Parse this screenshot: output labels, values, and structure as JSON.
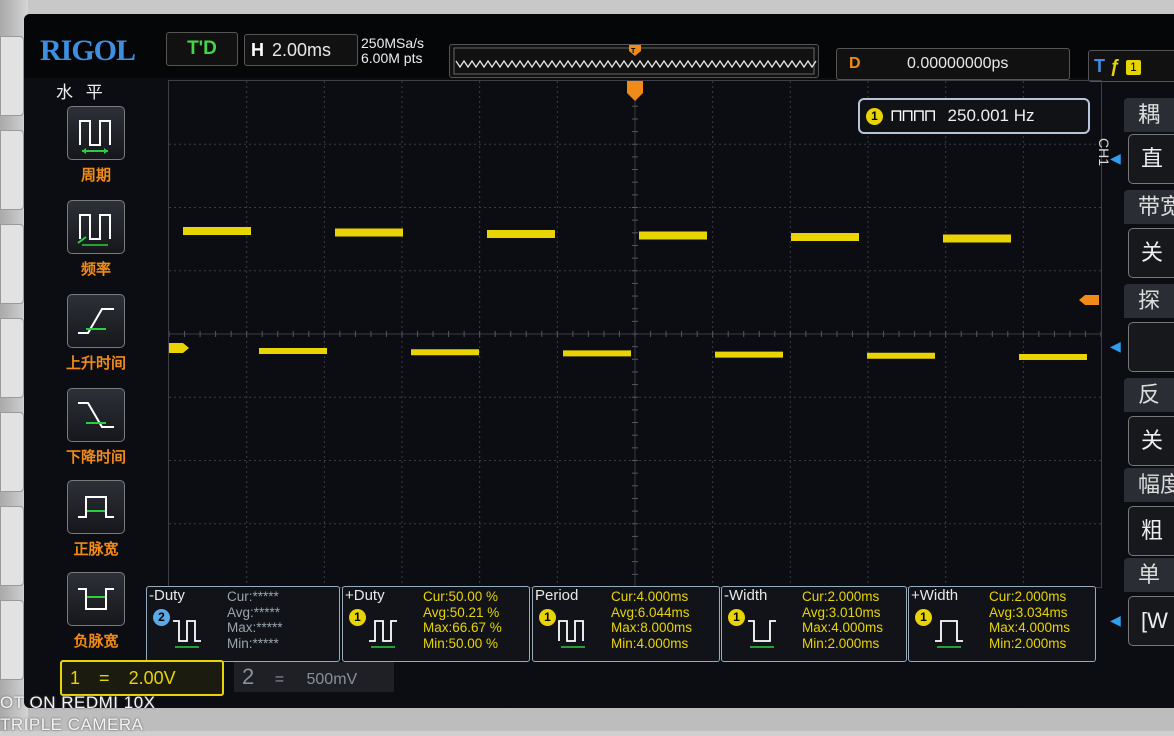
{
  "brand": "RIGOL",
  "status": "T'D",
  "timebase": {
    "label": "H",
    "value": "2.00ms"
  },
  "acquisition": {
    "sample_rate": "250MSa/s",
    "points": "6.00M pts"
  },
  "delay": {
    "label": "D",
    "value": "0.00000000ps"
  },
  "trigger": {
    "label": "T",
    "channel": "1"
  },
  "left_menu": {
    "title": "水 平",
    "items": [
      {
        "label": "周期",
        "icon": "period-icon"
      },
      {
        "label": "频率",
        "icon": "frequency-icon"
      },
      {
        "label": "上升时间",
        "icon": "rise-time-icon"
      },
      {
        "label": "下降时间",
        "icon": "fall-time-icon"
      },
      {
        "label": "正脉宽",
        "icon": "positive-width-icon"
      },
      {
        "label": "负脉宽",
        "icon": "negative-width-icon"
      }
    ]
  },
  "right_menu": [
    {
      "head": "耦",
      "value": "直"
    },
    {
      "head": "带宽",
      "value": "关"
    },
    {
      "head": "探",
      "value": ""
    },
    {
      "head": "反",
      "value": "关"
    },
    {
      "head": "幅度",
      "value": "粗"
    },
    {
      "head": "单",
      "value": "[W"
    }
  ],
  "right_menu_side_label": "CH1",
  "frequency_counter": {
    "channel": "1",
    "value": "250.001 Hz"
  },
  "measurements": [
    {
      "title": "-Duty",
      "channel": "2",
      "cur": "Cur:*****",
      "avg": "Avg:*****",
      "max": "Max:*****",
      "min": "Min:*****"
    },
    {
      "title": "+Duty",
      "channel": "1",
      "cur": "Cur:50.00 %",
      "avg": "Avg:50.21 %",
      "max": "Max:66.67 %",
      "min": "Min:50.00 %"
    },
    {
      "title": "Period",
      "channel": "1",
      "cur": "Cur:4.000ms",
      "avg": "Avg:6.044ms",
      "max": "Max:8.000ms",
      "min": "Min:4.000ms"
    },
    {
      "title": "-Width",
      "channel": "1",
      "cur": "Cur:2.000ms",
      "avg": "Avg:3.010ms",
      "max": "Max:4.000ms",
      "min": "Min:2.000ms"
    },
    {
      "title": "+Width",
      "channel": "1",
      "cur": "Cur:2.000ms",
      "avg": "Avg:3.034ms",
      "max": "Max:4.000ms",
      "min": "Min:2.000ms"
    }
  ],
  "channels": [
    {
      "num": "1",
      "sep": "=",
      "scale": "2.00V"
    },
    {
      "num": "2",
      "sep": "=",
      "scale": "500mV"
    }
  ],
  "watermark": {
    "line1": "OT ON REDMI 10X",
    "line2": "TRIPLE CAMERA"
  },
  "colors": {
    "ch1": "#e8d400",
    "accent": "#f08a18",
    "brand": "#3f8fe0",
    "status": "#43d64a"
  },
  "waveform": {
    "type": "square",
    "frequency_hz": 250.001,
    "duty_percent": 50.0,
    "periods_visible": 6
  }
}
